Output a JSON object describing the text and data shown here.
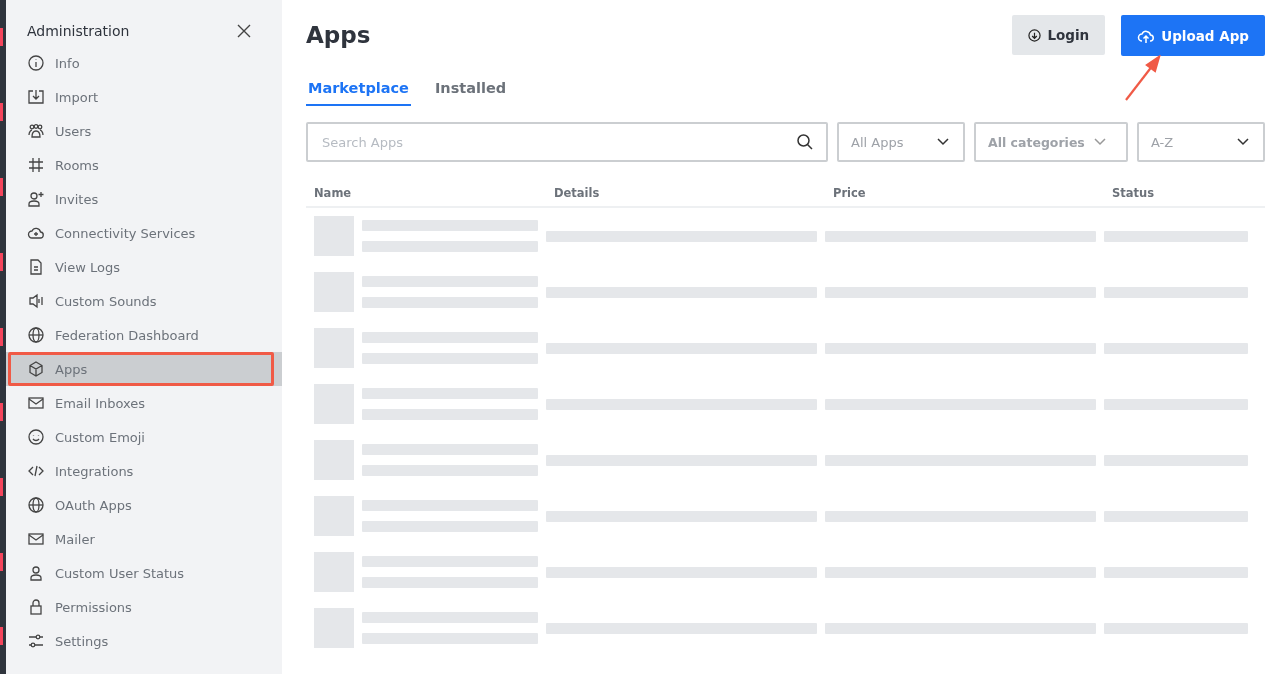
{
  "sidebar": {
    "title": "Administration",
    "items": [
      {
        "label": "Info",
        "kind": "info",
        "selected": false
      },
      {
        "label": "Import",
        "kind": "import",
        "selected": false
      },
      {
        "label": "Users",
        "kind": "users",
        "selected": false
      },
      {
        "label": "Rooms",
        "kind": "hash",
        "selected": false
      },
      {
        "label": "Invites",
        "kind": "invite",
        "selected": false
      },
      {
        "label": "Connectivity Services",
        "kind": "cloud",
        "selected": false
      },
      {
        "label": "View Logs",
        "kind": "file",
        "selected": false
      },
      {
        "label": "Custom Sounds",
        "kind": "sound",
        "selected": false
      },
      {
        "label": "Federation Dashboard",
        "kind": "globe",
        "selected": false
      },
      {
        "label": "Apps",
        "kind": "cube",
        "selected": true
      },
      {
        "label": "Email Inboxes",
        "kind": "mail",
        "selected": false
      },
      {
        "label": "Custom Emoji",
        "kind": "smile",
        "selected": false
      },
      {
        "label": "Integrations",
        "kind": "code",
        "selected": false
      },
      {
        "label": "OAuth Apps",
        "kind": "globe",
        "selected": false
      },
      {
        "label": "Mailer",
        "kind": "mail",
        "selected": false
      },
      {
        "label": "Custom User Status",
        "kind": "user",
        "selected": false
      },
      {
        "label": "Permissions",
        "kind": "lock",
        "selected": false
      },
      {
        "label": "Settings",
        "kind": "sliders",
        "selected": false
      }
    ]
  },
  "page": {
    "title": "Apps",
    "buttons": [
      {
        "label": "Login",
        "kind": "secondary"
      },
      {
        "label": "Upload App",
        "kind": "primary"
      }
    ]
  },
  "tabs": [
    {
      "label": "Marketplace",
      "selected": true
    },
    {
      "label": "Installed",
      "selected": false
    }
  ],
  "search": {
    "placeholder": "Search Apps"
  },
  "filters": [
    "All Apps",
    "All categories",
    "A-Z"
  ],
  "table": {
    "columns": [
      "Name",
      "Details",
      "Price",
      "Status"
    ]
  }
}
